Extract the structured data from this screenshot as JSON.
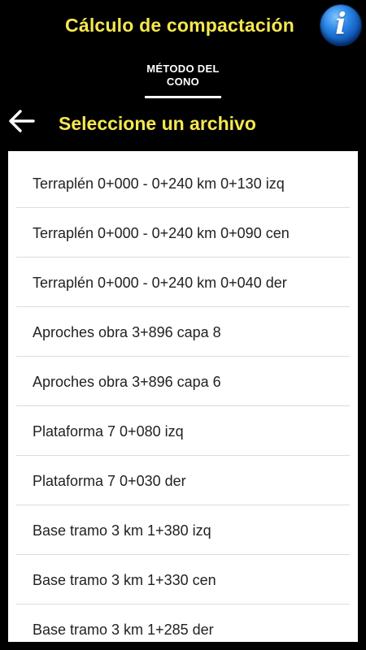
{
  "header": {
    "title": "Cálculo de compactación",
    "info_icon": "info-icon"
  },
  "tabs": [
    {
      "label": "MÉTODO DEL\nCONO",
      "selected": true
    }
  ],
  "screen": {
    "heading": "Seleccione un archivo",
    "back_icon": "arrow-back-icon"
  },
  "files": [
    "Terraplén 0+000 - 0+240 km 0+130 izq",
    "Terraplén 0+000 - 0+240 km 0+090 cen",
    "Terraplén 0+000 - 0+240 km 0+040 der",
    "Aproches obra 3+896 capa 8",
    "Aproches obra 3+896 capa 6",
    "Plataforma 7 0+080 izq",
    "Plataforma 7 0+030 der",
    "Base tramo 3 km 1+380 izq",
    "Base tramo 3 km 1+330 cen",
    "Base tramo 3 km 1+285 der"
  ],
  "colors": {
    "background": "#000000",
    "accent_yellow": "#f5e74f",
    "list_background": "#ffffff",
    "info_blue": "#1565c0"
  }
}
